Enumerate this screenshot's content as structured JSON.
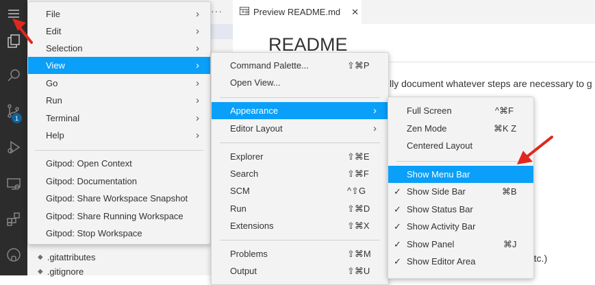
{
  "activity_bar": {
    "scm_badge": "1",
    "icons": [
      "menu-icon",
      "explorer-icon",
      "search-icon",
      "source-control-icon",
      "run-debug-icon",
      "remote-explorer-icon",
      "extensions-icon",
      "github-icon"
    ]
  },
  "sidebar": {
    "more_actions": "···",
    "files": [
      ".gitattributes",
      ".gitignore"
    ]
  },
  "editor": {
    "tab_label": "Preview README.md",
    "title": "README",
    "line1": "lly document whatever steps are necessary to g",
    "line2": "etc.)"
  },
  "main_menu": {
    "items": [
      {
        "label": "File",
        "submenu": true
      },
      {
        "label": "Edit",
        "submenu": true
      },
      {
        "label": "Selection",
        "submenu": true
      },
      {
        "label": "View",
        "submenu": true,
        "selected": true
      },
      {
        "label": "Go",
        "submenu": true
      },
      {
        "label": "Run",
        "submenu": true
      },
      {
        "label": "Terminal",
        "submenu": true
      },
      {
        "label": "Help",
        "submenu": true
      }
    ],
    "gitpod_items": [
      "Gitpod: Open Context",
      "Gitpod: Documentation",
      "Gitpod: Share Workspace Snapshot",
      "Gitpod: Share Running Workspace",
      "Gitpod: Stop Workspace"
    ]
  },
  "view_menu": {
    "group1": [
      {
        "label": "Command Palette...",
        "shortcut": "⇧⌘P"
      },
      {
        "label": "Open View...",
        "shortcut": ""
      }
    ],
    "group2": [
      {
        "label": "Appearance",
        "submenu": true,
        "selected": true
      },
      {
        "label": "Editor Layout",
        "submenu": true
      }
    ],
    "group3": [
      {
        "label": "Explorer",
        "shortcut": "⇧⌘E"
      },
      {
        "label": "Search",
        "shortcut": "⇧⌘F"
      },
      {
        "label": "SCM",
        "shortcut": "^⇧G"
      },
      {
        "label": "Run",
        "shortcut": "⇧⌘D"
      },
      {
        "label": "Extensions",
        "shortcut": "⇧⌘X"
      }
    ],
    "group4": [
      {
        "label": "Problems",
        "shortcut": "⇧⌘M"
      },
      {
        "label": "Output",
        "shortcut": "⇧⌘U"
      }
    ]
  },
  "appearance_menu": {
    "group1": [
      {
        "label": "Full Screen",
        "shortcut": "^⌘F"
      },
      {
        "label": "Zen Mode",
        "shortcut": "⌘K Z"
      },
      {
        "label": "Centered Layout",
        "shortcut": ""
      }
    ],
    "group2": [
      {
        "label": "Show Menu Bar",
        "shortcut": "",
        "checked": false,
        "selected": true
      },
      {
        "label": "Show Side Bar",
        "shortcut": "⌘B",
        "checked": true
      },
      {
        "label": "Show Status Bar",
        "shortcut": "",
        "checked": true
      },
      {
        "label": "Show Activity Bar",
        "shortcut": "",
        "checked": true
      },
      {
        "label": "Show Panel",
        "shortcut": "⌘J",
        "checked": true
      },
      {
        "label": "Show Editor Area",
        "shortcut": "",
        "checked": true
      }
    ],
    "check_glyph": "✓"
  },
  "colors": {
    "selection": "#0a9ff8",
    "annotation_arrow": "#e0281e",
    "activity_bar": "#2c2c2c"
  }
}
